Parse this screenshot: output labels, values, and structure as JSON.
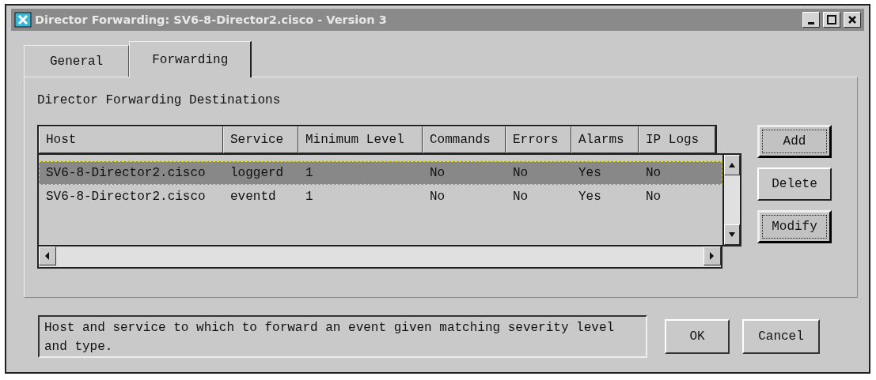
{
  "window": {
    "title": "Director Forwarding: SV6-8-Director2.cisco - Version 3"
  },
  "tabs": [
    {
      "label": "General",
      "selected": false
    },
    {
      "label": "Forwarding",
      "selected": true
    }
  ],
  "section_label": "Director Forwarding Destinations",
  "table": {
    "columns": [
      "Host",
      "Service",
      "Minimum Level",
      "Commands",
      "Errors",
      "Alarms",
      "IP Logs"
    ],
    "rows": [
      {
        "cells": [
          "SV6-8-Director2.cisco",
          "loggerd",
          "1",
          "No",
          "No",
          "Yes",
          "No"
        ],
        "selected": true
      },
      {
        "cells": [
          "SV6-8-Director2.cisco",
          "eventd",
          "1",
          "No",
          "No",
          "Yes",
          "No"
        ],
        "selected": false
      }
    ]
  },
  "side_buttons": [
    {
      "label": "Add",
      "focused": true
    },
    {
      "label": "Delete",
      "focused": false
    },
    {
      "label": "Modify",
      "focused": true
    }
  ],
  "status_text": "Host and service to which to forward an event given matching severity level and type.",
  "dialog_buttons": [
    "OK",
    "Cancel"
  ]
}
